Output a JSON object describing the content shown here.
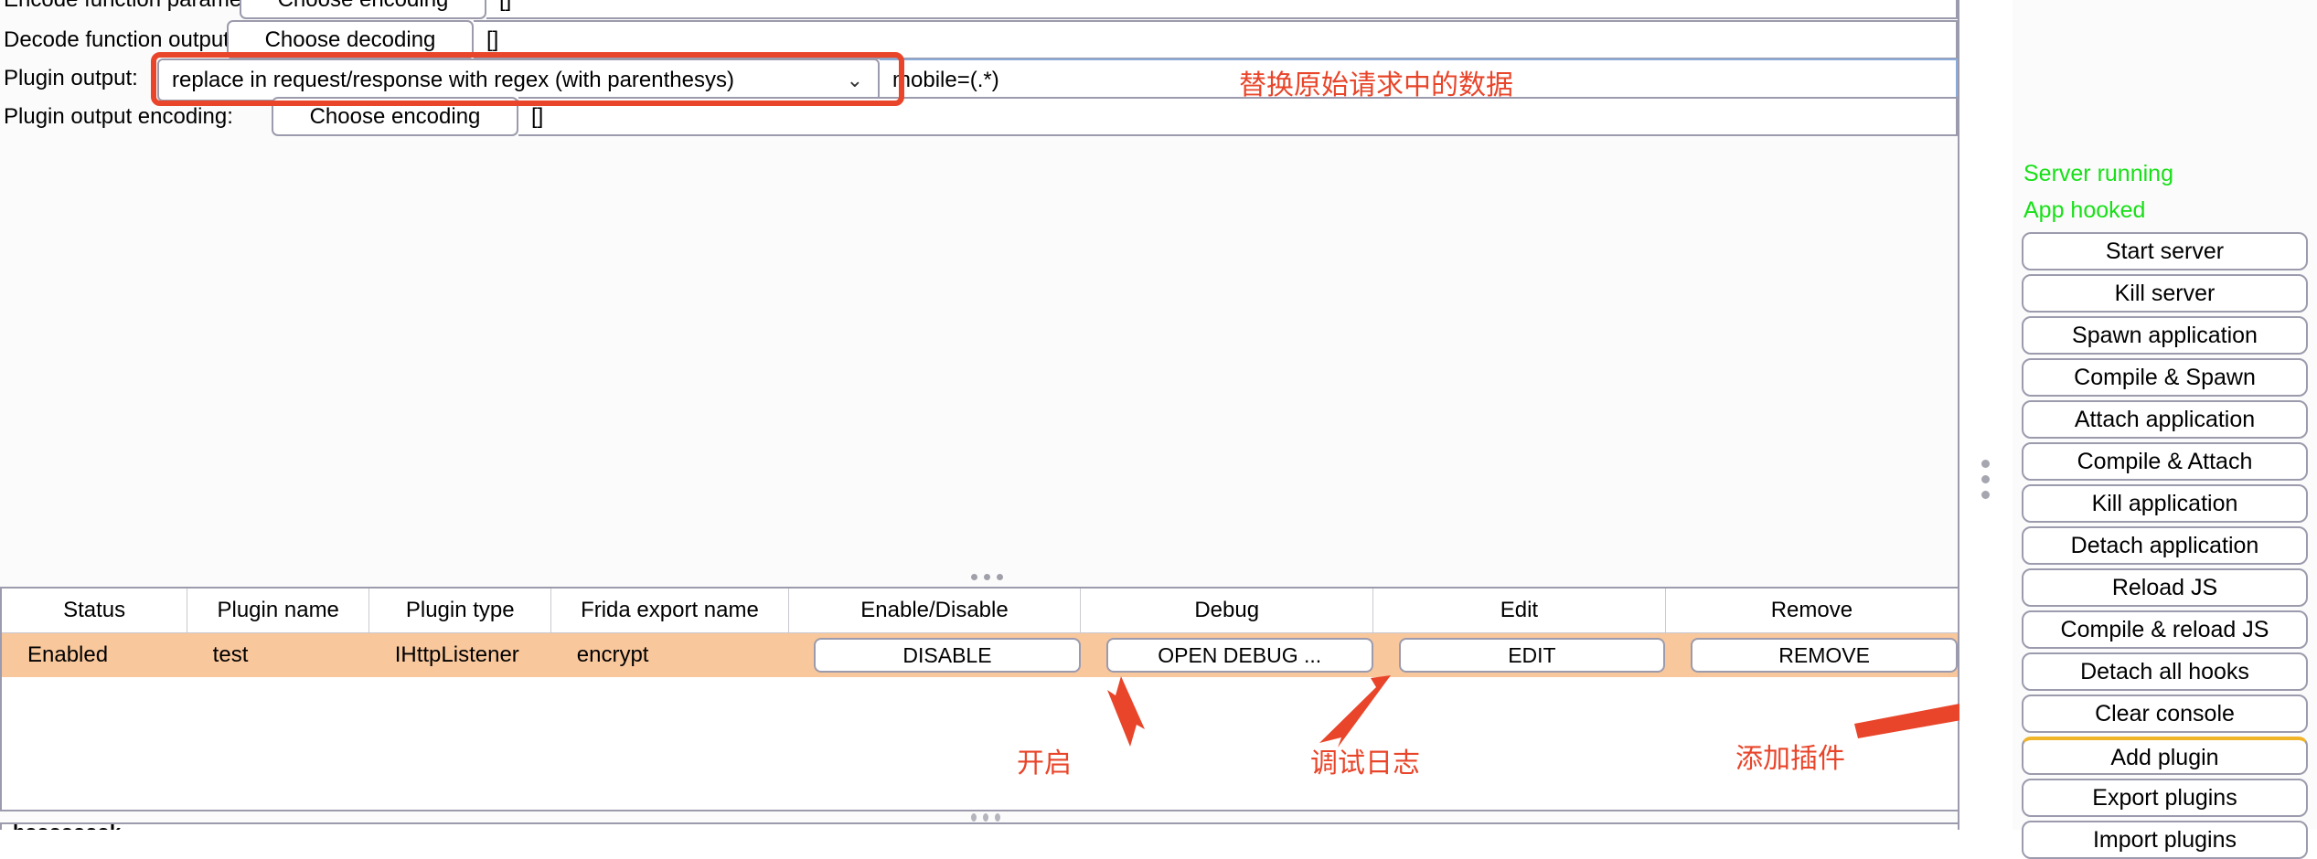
{
  "form": {
    "rows": [
      {
        "label": "Encode function parameters:",
        "button": "Choose encoding",
        "value": "[]"
      },
      {
        "label": "Decode function output:",
        "button": "Choose decoding",
        "value": "[]"
      },
      {
        "label": "Plugin output encoding:",
        "button": "Choose encoding",
        "value": "[]"
      }
    ],
    "plugin_output": {
      "label": "Plugin output:",
      "selected": "replace in request/response with regex (with parenthesys)",
      "chevron": "⌄",
      "value": "mobile=(.*)"
    }
  },
  "annotations": {
    "replace_data": "替换原始请求中的数据",
    "enable": "开启",
    "debug_log": "调试日志",
    "add_plugin": "添加插件",
    "color": "#e8452a"
  },
  "table": {
    "headers": [
      "Status",
      "Plugin name",
      "Plugin type",
      "Frida export name",
      "Enable/Disable",
      "Debug",
      "Edit",
      "Remove"
    ],
    "rows": [
      {
        "status": "Enabled",
        "name": "test",
        "type": "IHttpListener",
        "export": "encrypt",
        "enable_btn": "DISABLE",
        "debug_btn": "OPEN DEBUG ...",
        "edit_btn": "EDIT",
        "remove_btn": "REMOVE"
      }
    ],
    "row_highlight_color": "#f9c79c",
    "status_color": "#16e516"
  },
  "console": {
    "partial_text": "hoooooook"
  },
  "sidebar": {
    "status": [
      {
        "text": "Server running",
        "color": "#18e018"
      },
      {
        "text": "App hooked",
        "color": "#18e018"
      }
    ],
    "buttons": [
      {
        "label": "Start server"
      },
      {
        "label": "Kill server"
      },
      {
        "label": "Spawn application"
      },
      {
        "label": "Compile & Spawn"
      },
      {
        "label": "Attach application"
      },
      {
        "label": "Compile & Attach"
      },
      {
        "label": "Kill application"
      },
      {
        "label": "Detach application"
      },
      {
        "label": "Reload JS"
      },
      {
        "label": "Compile & reload JS"
      },
      {
        "label": "Detach all hooks"
      },
      {
        "label": "Clear console"
      },
      {
        "label": "Add plugin",
        "accent": "#f0b429"
      },
      {
        "label": "Export plugins"
      },
      {
        "label": "Import plugins"
      }
    ]
  }
}
